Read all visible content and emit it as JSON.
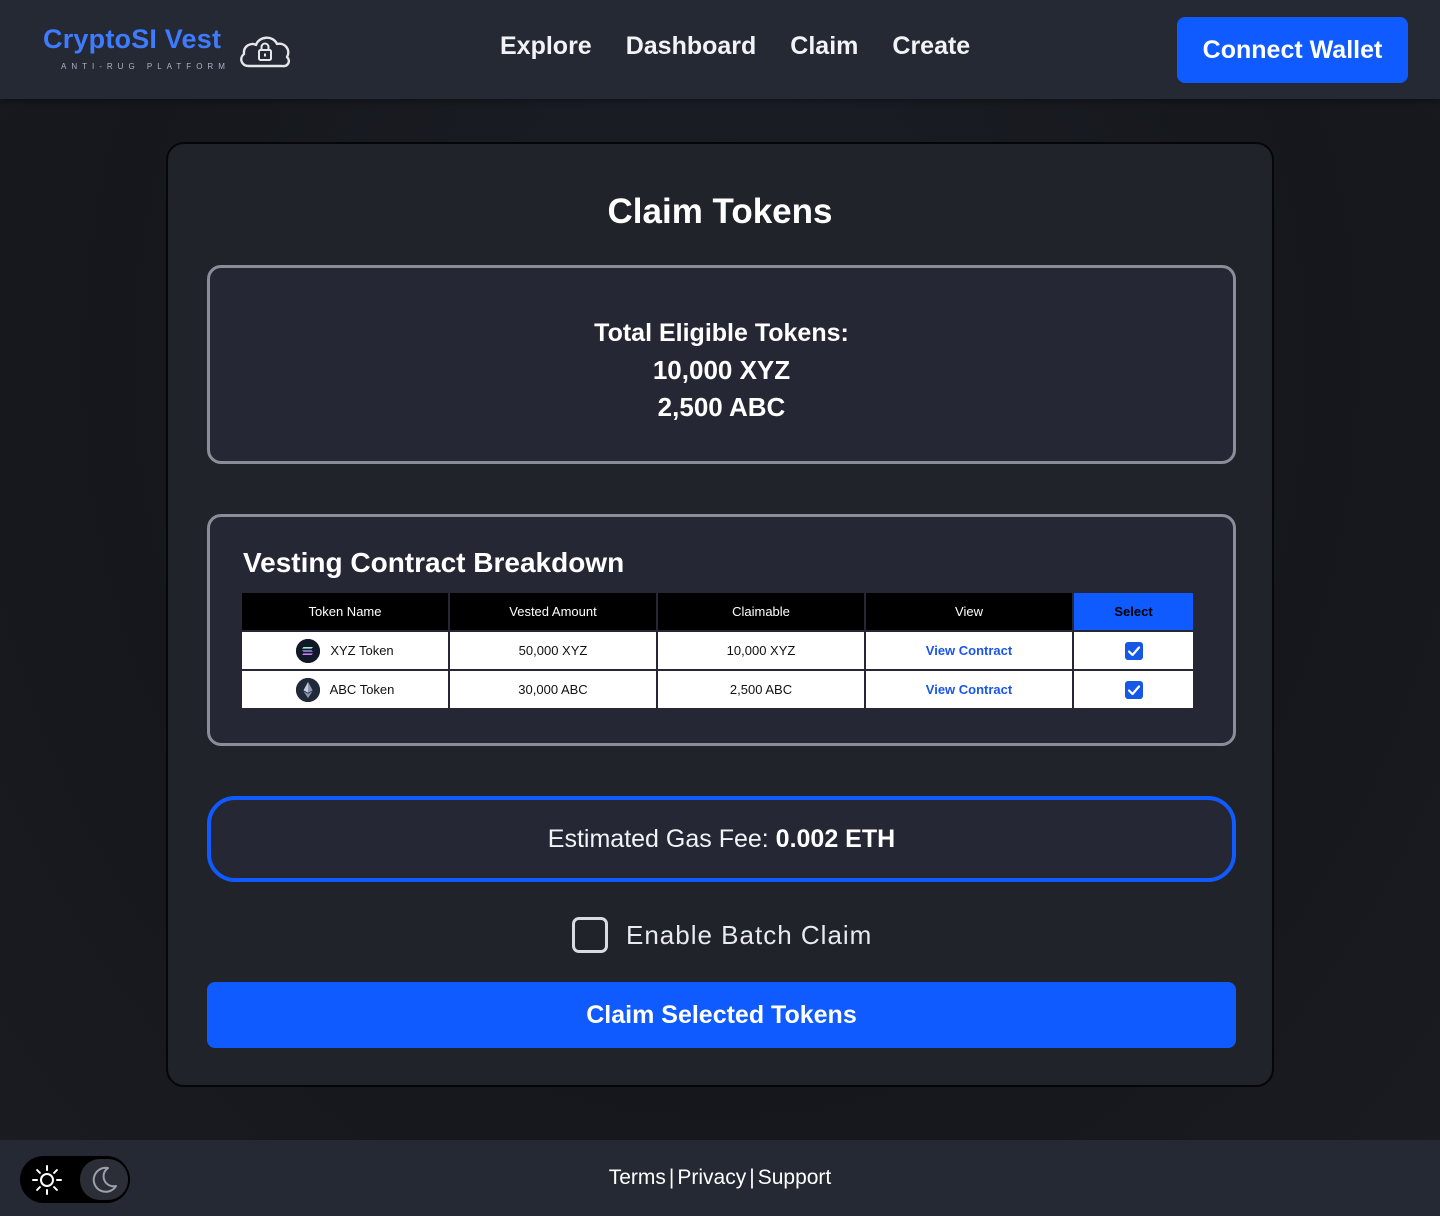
{
  "header": {
    "logo_title": "CryptoSI Vest",
    "logo_tagline": "ANTI-RUG PLATFORM",
    "nav": [
      "Explore",
      "Dashboard",
      "Claim",
      "Create"
    ],
    "connect_wallet": "Connect Wallet"
  },
  "main": {
    "title": "Claim Tokens",
    "total": {
      "label": "Total Eligible Tokens:",
      "lines": [
        "10,000 XYZ",
        "2,500 ABC"
      ]
    },
    "breakdown": {
      "title": "Vesting Contract Breakdown",
      "columns": [
        "Token Name",
        "Vested Amount",
        "Claimable",
        "View",
        "Select"
      ],
      "rows": [
        {
          "token": "XYZ Token",
          "icon": "solana-icon",
          "vested": "50,000 XYZ",
          "claimable": "10,000 XYZ",
          "view": "View Contract",
          "selected": true
        },
        {
          "token": "ABC Token",
          "icon": "ethereum-icon",
          "vested": "30,000 ABC",
          "claimable": "2,500 ABC",
          "view": "View Contract",
          "selected": true
        }
      ]
    },
    "gas": {
      "label": "Estimated Gas Fee: ",
      "value": "0.002 ETH"
    },
    "batch_claim": {
      "label": "Enable Batch Claim",
      "checked": false
    },
    "claim_button": "Claim Selected Tokens"
  },
  "footer": {
    "links": [
      "Terms",
      "Privacy",
      "Support"
    ],
    "separator": "|",
    "theme_icons": [
      "sun-icon",
      "moon-icon"
    ]
  },
  "colors": {
    "accent": "#0f5bff",
    "header_bg": "#252934",
    "card_bg": "#21232a"
  }
}
